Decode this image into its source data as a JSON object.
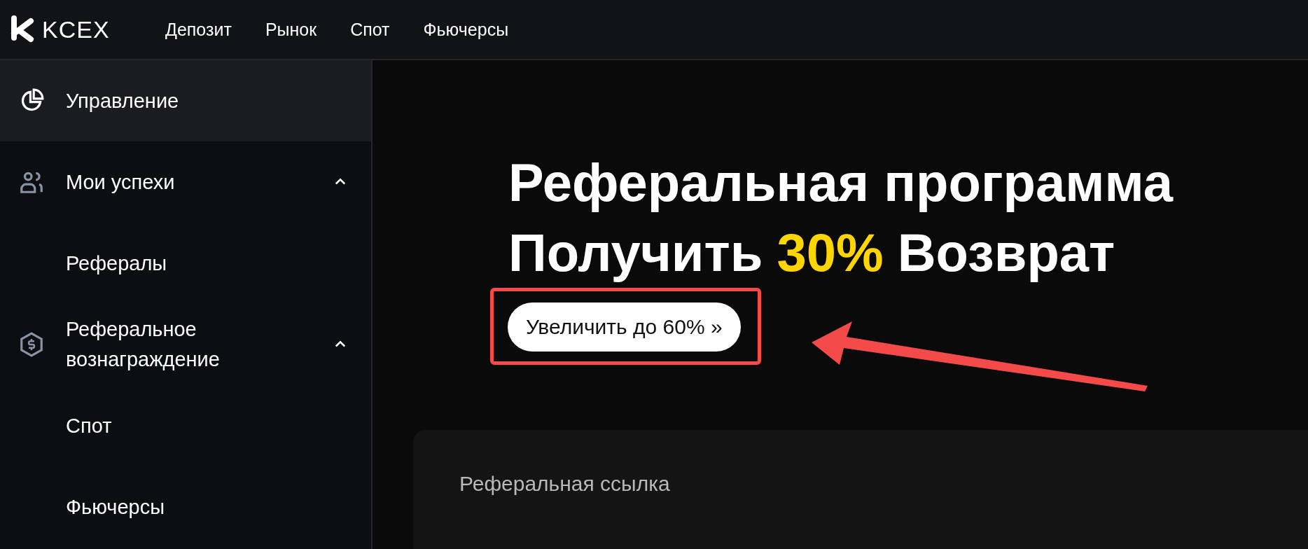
{
  "header": {
    "logo": "KCEX",
    "nav": [
      {
        "label": "Депозит"
      },
      {
        "label": "Рынок"
      },
      {
        "label": "Спот"
      },
      {
        "label": "Фьючерсы"
      }
    ]
  },
  "sidebar": {
    "items": [
      {
        "label": "Управление",
        "kind": "chart",
        "selected": true
      },
      {
        "label": "Мои успехи",
        "kind": "users",
        "selected": false,
        "expanded": true,
        "children": [
          {
            "label": "Рефералы",
            "selected": false
          }
        ]
      },
      {
        "label": "Реферальное вознаграждение",
        "kind": "dollar",
        "selected": false,
        "expanded": true,
        "children": [
          {
            "label": "Спот",
            "selected": false
          },
          {
            "label": "Фьючерсы",
            "selected": false
          }
        ]
      }
    ]
  },
  "hero": {
    "title": "Реферальная программа",
    "subtitle_prefix": "Получить",
    "subtitle_highlight": "30%",
    "subtitle_suffix": "Возврат",
    "button": "Увеличить до 60% »"
  },
  "card": {
    "title": "Реферальная ссылка"
  }
}
